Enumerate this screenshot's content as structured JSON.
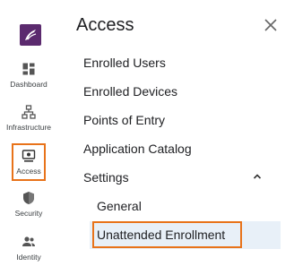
{
  "rail": {
    "logo": "brand-logo",
    "items": [
      {
        "id": "dashboard",
        "label": "Dashboard",
        "icon": "dashboard-icon"
      },
      {
        "id": "infrastructure",
        "label": "Infrastructure",
        "icon": "infrastructure-icon"
      },
      {
        "id": "access",
        "label": "Access",
        "icon": "access-icon",
        "active": true
      },
      {
        "id": "security",
        "label": "Security",
        "icon": "shield-icon"
      },
      {
        "id": "identity",
        "label": "Identity",
        "icon": "people-icon"
      }
    ]
  },
  "panel": {
    "title": "Access",
    "close_icon": "close-icon",
    "items": [
      {
        "label": "Enrolled Users"
      },
      {
        "label": "Enrolled Devices"
      },
      {
        "label": "Points of Entry"
      },
      {
        "label": "Application Catalog"
      },
      {
        "label": "Settings",
        "expanded": true
      }
    ],
    "settings_children": [
      {
        "label": "General"
      },
      {
        "label": "Unattended Enrollment",
        "selected": true
      }
    ]
  },
  "colors": {
    "brand": "#5b2a6e",
    "highlight": "#e8731a",
    "selected_bg": "#e8f0f8"
  }
}
